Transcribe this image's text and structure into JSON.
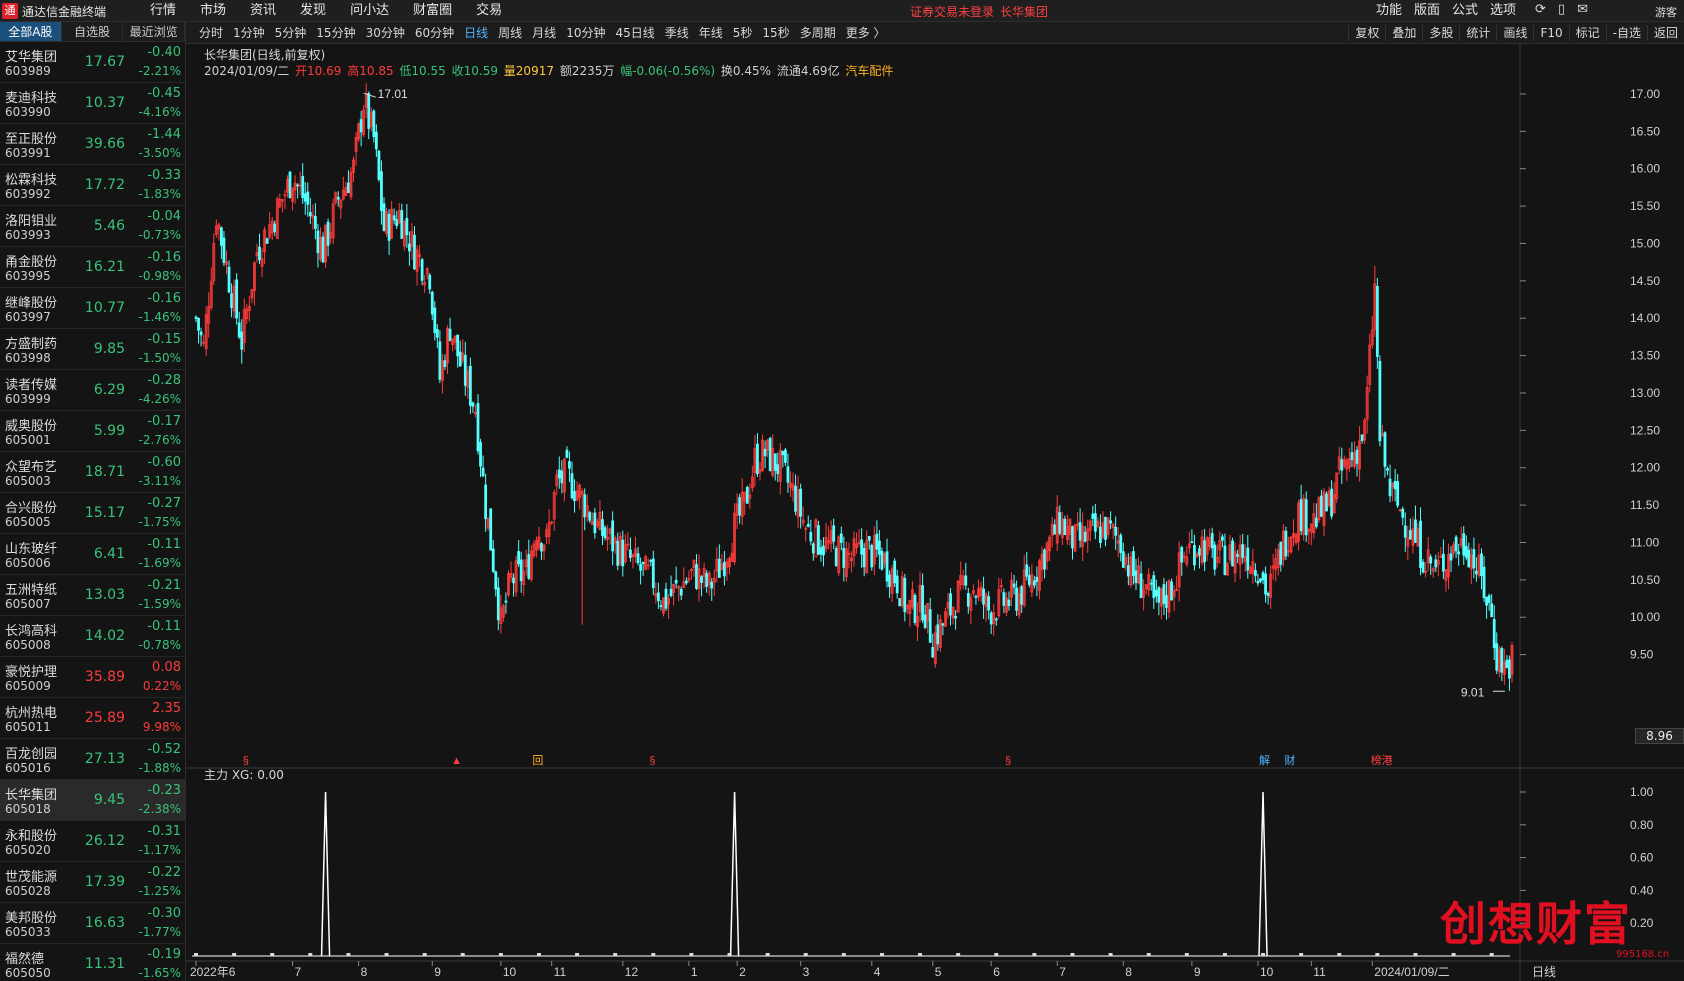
{
  "app": {
    "title": "通达信金融终端",
    "logo": "logo-icon"
  },
  "mainmenu": [
    "行情",
    "市场",
    "资讯",
    "发现",
    "问小达",
    "财富圈",
    "交易"
  ],
  "notice": {
    "login": "证券交易未登录",
    "stock": "长华集团"
  },
  "rightmenu": [
    "功能",
    "版面",
    "公式",
    "选项"
  ],
  "topicons": [
    "refresh-icon",
    "phone-icon",
    "mail-icon"
  ],
  "guest": "游客",
  "sidebar": {
    "tabs": [
      "全部A股",
      "自选股",
      "最近浏览"
    ],
    "rows": [
      {
        "name": "艾华集团",
        "code": "603989",
        "price": "17.67",
        "chg": "-0.40",
        "pct": "-2.21%",
        "nc": "w",
        "pc": "g"
      },
      {
        "name": "麦迪科技",
        "code": "603990",
        "price": "10.37",
        "chg": "-0.45",
        "pct": "-4.16%",
        "nc": "w",
        "pc": "g"
      },
      {
        "name": "至正股份",
        "code": "603991",
        "price": "39.66",
        "chg": "-1.44",
        "pct": "-3.50%",
        "nc": "w",
        "pc": "g"
      },
      {
        "name": "松霖科技",
        "code": "603992",
        "price": "17.72",
        "chg": "-0.33",
        "pct": "-1.83%",
        "nc": "w",
        "pc": "g"
      },
      {
        "name": "洛阳钼业",
        "code": "603993",
        "price": "5.46",
        "chg": "-0.04",
        "pct": "-0.73%",
        "nc": "w",
        "pc": "g"
      },
      {
        "name": "甬金股份",
        "code": "603995",
        "price": "16.21",
        "chg": "-0.16",
        "pct": "-0.98%",
        "nc": "c",
        "pc": "g"
      },
      {
        "name": "继峰股份",
        "code": "603997",
        "price": "10.77",
        "chg": "-0.16",
        "pct": "-1.46%",
        "nc": "w",
        "pc": "g"
      },
      {
        "name": "方盛制药",
        "code": "603998",
        "price": "9.85",
        "chg": "-0.15",
        "pct": "-1.50%",
        "nc": "w",
        "pc": "g"
      },
      {
        "name": "读者传媒",
        "code": "603999",
        "price": "6.29",
        "chg": "-0.28",
        "pct": "-4.26%",
        "nc": "c",
        "pc": "g"
      },
      {
        "name": "威奥股份",
        "code": "605001",
        "price": "5.99",
        "chg": "-0.17",
        "pct": "-2.76%",
        "nc": "w",
        "pc": "g"
      },
      {
        "name": "众望布艺",
        "code": "605003",
        "price": "18.71",
        "chg": "-0.60",
        "pct": "-3.11%",
        "nc": "w",
        "pc": "g"
      },
      {
        "name": "合兴股份",
        "code": "605005",
        "price": "15.17",
        "chg": "-0.27",
        "pct": "-1.75%",
        "nc": "w",
        "pc": "g"
      },
      {
        "name": "山东玻纤",
        "code": "605006",
        "price": "6.41",
        "chg": "-0.11",
        "pct": "-1.69%",
        "nc": "c",
        "pc": "g"
      },
      {
        "name": "五洲特纸",
        "code": "605007",
        "price": "13.03",
        "chg": "-0.21",
        "pct": "-1.59%",
        "nc": "w",
        "pc": "g"
      },
      {
        "name": "长鸿高科",
        "code": "605008",
        "price": "14.02",
        "chg": "-0.11",
        "pct": "-0.78%",
        "nc": "w",
        "pc": "g"
      },
      {
        "name": "豪悦护理",
        "code": "605009",
        "price": "35.89",
        "chg": "0.08",
        "pct": "0.22%",
        "nc": "w",
        "pc": "r"
      },
      {
        "name": "杭州热电",
        "code": "605011",
        "price": "25.89",
        "chg": "2.35",
        "pct": "9.98%",
        "nc": "w",
        "pc": "r"
      },
      {
        "name": "百龙创园",
        "code": "605016",
        "price": "27.13",
        "chg": "-0.52",
        "pct": "-1.88%",
        "nc": "w",
        "pc": "g"
      },
      {
        "name": "长华集团",
        "code": "605018",
        "price": "9.45",
        "chg": "-0.23",
        "pct": "-2.38%",
        "nc": "c",
        "pc": "g",
        "sel": true
      },
      {
        "name": "永和股份",
        "code": "605020",
        "price": "26.12",
        "chg": "-0.31",
        "pct": "-1.17%",
        "nc": "w",
        "pc": "g"
      },
      {
        "name": "世茂能源",
        "code": "605028",
        "price": "17.39",
        "chg": "-0.22",
        "pct": "-1.25%",
        "nc": "m",
        "pc": "g"
      },
      {
        "name": "美邦股份",
        "code": "605033",
        "price": "16.63",
        "chg": "-0.30",
        "pct": "-1.77%",
        "nc": "w",
        "pc": "g"
      },
      {
        "name": "福然德",
        "code": "605050",
        "price": "11.31",
        "chg": "-0.19",
        "pct": "-1.65%",
        "nc": "w",
        "pc": "g"
      }
    ]
  },
  "periods": [
    "分时",
    "1分钟",
    "5分钟",
    "15分钟",
    "30分钟",
    "60分钟",
    "日线",
    "周线",
    "月线",
    "10分钟",
    "45日线",
    "季线",
    "年线",
    "5秒",
    "15秒",
    "多周期",
    "更多 〉"
  ],
  "active_period": "日线",
  "tools": [
    "复权",
    "叠加",
    "多股",
    "统计",
    "画线",
    "F10",
    "标记",
    "-自选",
    "返回"
  ],
  "chart_title": "长华集团(日线,前复权)",
  "info": {
    "date": "2024/01/09/二",
    "open": "开10.69",
    "high": "高10.85",
    "low": "低10.55",
    "close": "收10.59",
    "vol": "量20917",
    "amt": "额2235万",
    "chg": "幅-0.06(-0.56%)",
    "turn": "换0.45%",
    "float": "流通4.69亿",
    "sector": "汽车配件"
  },
  "sub_indicator": "主力  XG: 0.00",
  "current_price_label": "8.96",
  "period_label": "日线",
  "watermark": {
    "text": "创想财富",
    "url": "995168.cn"
  },
  "chart_data": {
    "type": "candlestick",
    "ylim": [
      9.0,
      17.2
    ],
    "y_ticks": [
      "17.00",
      "16.50",
      "16.00",
      "15.50",
      "15.00",
      "14.50",
      "14.00",
      "13.50",
      "13.00",
      "12.50",
      "12.00",
      "11.50",
      "11.00",
      "10.50",
      "10.00",
      "9.50"
    ],
    "x_ticks": [
      "2022年6",
      "7",
      "8",
      "9",
      "10",
      "11",
      "12",
      "1",
      "2",
      "3",
      "4",
      "5",
      "6",
      "7",
      "8",
      "9",
      "10",
      "11",
      "2024/01/09/二"
    ],
    "max_label": "17.01",
    "min_label": "9.01",
    "close_path": [
      [
        0,
        14.0
      ],
      [
        3,
        13.6
      ],
      [
        8,
        15.4
      ],
      [
        12,
        14.7
      ],
      [
        18,
        13.7
      ],
      [
        24,
        14.9
      ],
      [
        30,
        15.3
      ],
      [
        38,
        15.9
      ],
      [
        44,
        15.5
      ],
      [
        50,
        14.9
      ],
      [
        56,
        15.6
      ],
      [
        62,
        16.0
      ],
      [
        66,
        16.9
      ],
      [
        70,
        16.4
      ],
      [
        74,
        15.2
      ],
      [
        80,
        15.4
      ],
      [
        86,
        14.9
      ],
      [
        92,
        14.6
      ],
      [
        96,
        13.2
      ],
      [
        100,
        13.9
      ],
      [
        104,
        13.4
      ],
      [
        110,
        12.8
      ],
      [
        114,
        11.5
      ],
      [
        118,
        10.5
      ],
      [
        120,
        9.9
      ],
      [
        124,
        10.5
      ],
      [
        130,
        10.6
      ],
      [
        134,
        11.2
      ],
      [
        138,
        11.0
      ],
      [
        142,
        11.8
      ],
      [
        146,
        11.9
      ],
      [
        152,
        11.6
      ],
      [
        158,
        11.2
      ],
      [
        164,
        11.0
      ],
      [
        170,
        10.8
      ],
      [
        176,
        10.6
      ],
      [
        180,
        10.5
      ],
      [
        184,
        10.2
      ],
      [
        190,
        10.4
      ],
      [
        196,
        10.6
      ],
      [
        202,
        10.4
      ],
      [
        208,
        10.8
      ],
      [
        212,
        11.2
      ],
      [
        216,
        11.5
      ],
      [
        220,
        12.1
      ],
      [
        224,
        12.2
      ],
      [
        230,
        12.0
      ],
      [
        236,
        11.6
      ],
      [
        240,
        11.2
      ],
      [
        246,
        11.0
      ],
      [
        252,
        10.9
      ],
      [
        258,
        10.8
      ],
      [
        264,
        10.9
      ],
      [
        270,
        10.8
      ],
      [
        276,
        10.5
      ],
      [
        280,
        10.1
      ],
      [
        286,
        10.2
      ],
      [
        290,
        9.7
      ],
      [
        294,
        9.9
      ],
      [
        300,
        10.3
      ],
      [
        306,
        10.4
      ],
      [
        312,
        10.1
      ],
      [
        318,
        10.2
      ],
      [
        324,
        10.3
      ],
      [
        330,
        10.6
      ],
      [
        336,
        11.0
      ],
      [
        340,
        11.3
      ],
      [
        346,
        11.0
      ],
      [
        352,
        11.1
      ],
      [
        358,
        11.2
      ],
      [
        364,
        11.0
      ],
      [
        368,
        10.6
      ],
      [
        374,
        10.4
      ],
      [
        378,
        10.1
      ],
      [
        384,
        10.4
      ],
      [
        390,
        10.9
      ],
      [
        396,
        11.0
      ],
      [
        400,
        10.8
      ],
      [
        406,
        10.8
      ],
      [
        412,
        10.9
      ],
      [
        418,
        10.7
      ],
      [
        422,
        10.3
      ],
      [
        428,
        11.0
      ],
      [
        434,
        11.4
      ],
      [
        440,
        11.3
      ],
      [
        446,
        11.5
      ],
      [
        450,
        11.9
      ],
      [
        456,
        12.2
      ],
      [
        460,
        12.5
      ],
      [
        464,
        14.4
      ],
      [
        466,
        12.4
      ],
      [
        470,
        11.7
      ],
      [
        476,
        11.3
      ],
      [
        482,
        10.9
      ],
      [
        488,
        10.6
      ],
      [
        494,
        10.9
      ],
      [
        500,
        11.0
      ],
      [
        506,
        10.5
      ],
      [
        510,
        10.0
      ],
      [
        512,
        9.5
      ],
      [
        516,
        9.3
      ],
      [
        518,
        9.45
      ]
    ],
    "spikes": [
      [
        152,
        9.9
      ],
      [
        244,
        11.2
      ],
      [
        464,
        14.7
      ]
    ],
    "flag_labels": [
      "§",
      "▲",
      "回",
      "§",
      "§",
      "解",
      "财",
      "榜港"
    ],
    "sub_y_ticks": [
      "1.00",
      "0.80",
      "0.60",
      "0.40",
      "0.20"
    ],
    "xg_signals": [
      {
        "date": "2022/07",
        "value": 1.0
      },
      {
        "date": "2023/02",
        "value": 1.0
      },
      {
        "date": "2023/11",
        "value": 1.0
      }
    ]
  }
}
